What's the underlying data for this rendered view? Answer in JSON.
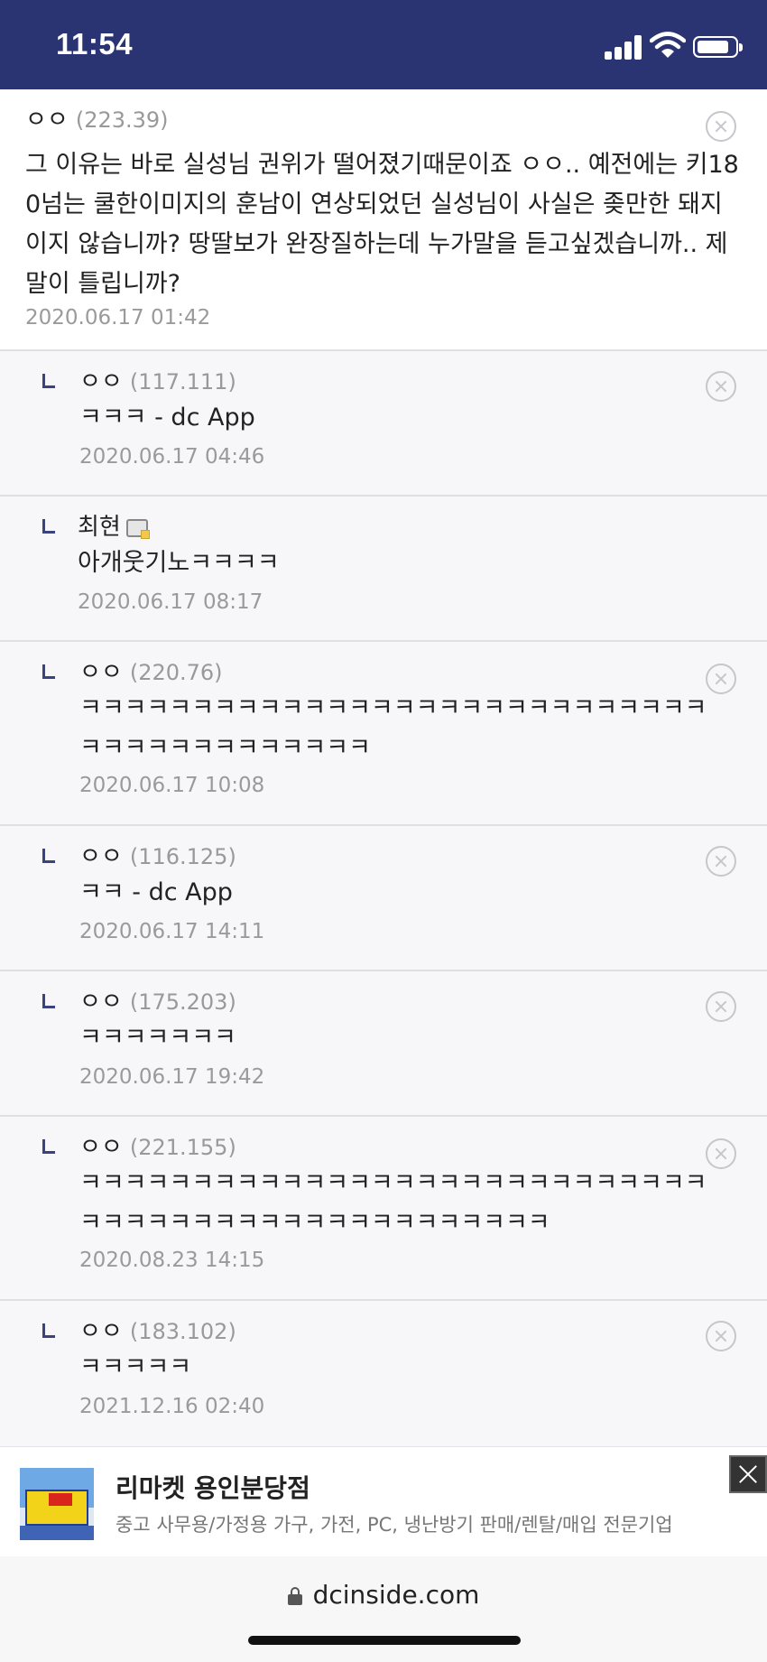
{
  "status_bar": {
    "time": "11:54",
    "icons": [
      "signal-icon",
      "wifi-icon",
      "battery-icon"
    ]
  },
  "comments": [
    {
      "nick": "ㅇㅇ",
      "ip": "(223.39)",
      "body": "그 이유는 바로 실성님 권위가 떨어졌기때문이죠 ㅇㅇ.. 예전에는 키180넘는 쿨한이미지의 훈남이 연상되었던 실성님이 사실은 좆만한 돼지이지 않습니까? 땅딸보가 완장질하는데 누가말을 듣고싶겠습니까.. 제 말이 틀립니까?",
      "date": "2020.06.17 01:42"
    },
    {
      "nick": "ㅇㅇ",
      "ip": "(117.111)",
      "body": "ㅋㅋㅋ - dc App",
      "date": "2020.06.17 04:46"
    },
    {
      "nick": "최현",
      "ip": "",
      "body": "아개웃기노ㅋㅋㅋㅋ",
      "date": "2020.06.17 08:17"
    },
    {
      "nick": "ㅇㅇ",
      "ip": "(220.76)",
      "body": "ㅋㅋㅋㅋㅋㅋㅋㅋㅋㅋㅋㅋㅋㅋㅋㅋㅋㅋㅋㅋㅋㅋㅋㅋㅋㅋㅋㅋㅋㅋㅋㅋㅋㅋㅋㅋㅋㅋㅋㅋㅋ",
      "date": "2020.06.17 10:08"
    },
    {
      "nick": "ㅇㅇ",
      "ip": "(116.125)",
      "body": "ㅋㅋ - dc App",
      "date": "2020.06.17 14:11"
    },
    {
      "nick": "ㅇㅇ",
      "ip": "(175.203)",
      "body": "ㅋㅋㅋㅋㅋㅋㅋ",
      "date": "2020.06.17 19:42"
    },
    {
      "nick": "ㅇㅇ",
      "ip": "(221.155)",
      "body": "ㅋㅋㅋㅋㅋㅋㅋㅋㅋㅋㅋㅋㅋㅋㅋㅋㅋㅋㅋㅋㅋㅋㅋㅋㅋㅋㅋㅋㅋㅋㅋㅋㅋㅋㅋㅋㅋㅋㅋㅋㅋㅋㅋㅋㅋㅋㅋㅋㅋ",
      "date": "2020.08.23 14:15"
    },
    {
      "nick": "ㅇㅇ",
      "ip": "(183.102)",
      "body": "ㅋㅋㅋㅋㅋ",
      "date": "2021.12.16 02:40"
    }
  ],
  "ad": {
    "title": "리마켓 용인분당점",
    "subtitle": "중고 사무용/가정용 가구, 가전, PC, 냉난방기 판매/렌탈/매입 전문기업"
  },
  "browser": {
    "url": "dcinside.com"
  }
}
